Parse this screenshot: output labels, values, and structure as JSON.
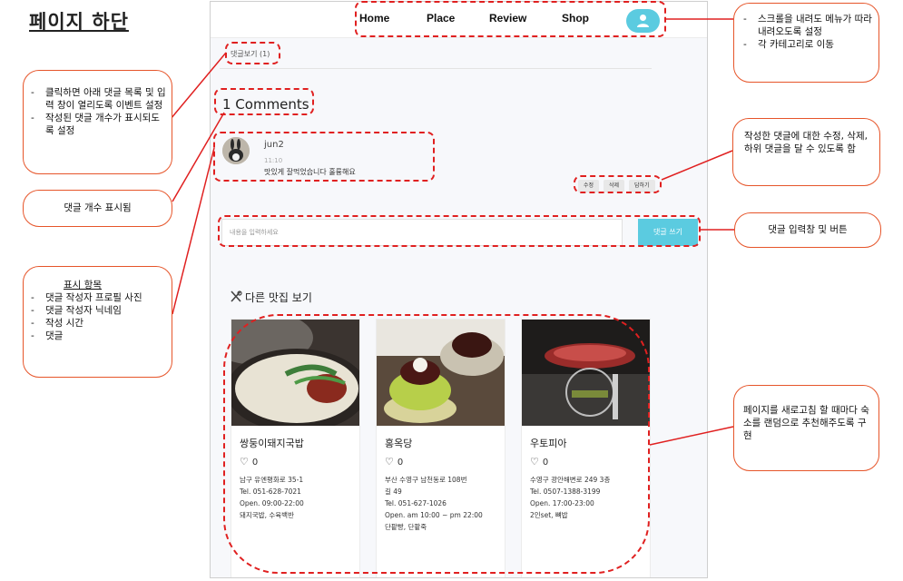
{
  "heading": "페이지 하단",
  "nav": {
    "items": [
      "Home",
      "Place",
      "Review",
      "Shop"
    ]
  },
  "comments_toggle": "댓글보기 (1)",
  "comments_title": "1 Comments",
  "comment": {
    "author": "jun2",
    "time": "11:10",
    "text": "맛있게 잘먹었습니다 훌륭해요"
  },
  "comment_actions": [
    "수정",
    "삭제",
    "답하기"
  ],
  "comment_input": {
    "placeholder": "내용을 입력하세요",
    "submit": "댓글 쓰기"
  },
  "more_title": "다른 맛집 보기",
  "restaurants": [
    {
      "name": "쌍둥이돼지국밥",
      "likes": "0",
      "info": [
        "남구 유엔평화로 35-1",
        "Tel. 051-628-7021",
        "Open. 09:00-22:00",
        "돼지국밥, 수육백반"
      ]
    },
    {
      "name": "홍옥당",
      "likes": "0",
      "info": [
        "부산 수영구 남천동로 108번",
        "길 49",
        "Tel. 051-627-1026",
        "Open. am 10:00 ~ pm 22:00",
        "단팥빵, 단팥죽"
      ]
    },
    {
      "name": "우토피아",
      "likes": "0",
      "info": [
        "수영구 광안해변로 249 3층",
        "Tel. 0507-1388-3199",
        "Open. 17:00-23:00",
        "2인set, 뼈밥"
      ]
    }
  ],
  "annotations": {
    "menu": [
      "스크롤을 내려도 메뉴가 따라 내려오도록 설정",
      "각 카테고리로 이동"
    ],
    "toggle": [
      "클릭하면 아래 댓글 목록 및 입력 창이 열리도록 이벤트 설정",
      "작성된 댓글 개수가 표시되도록 설정"
    ],
    "count": "댓글 개수 표시됨",
    "display_title": "표시 항목",
    "display_items": [
      "댓글 작성자 프로필 사진",
      "댓글 작성자 닉네임",
      "작성 시간",
      "댓글"
    ],
    "edit": "작성한 댓글에 대한 수정, 삭제, 하위 댓글을 달 수 있도록 함",
    "input": "댓글 입력창 및 버튼",
    "random": "페이지를 새로고침 할 때마다 숙소를 랜덤으로 추천해주도록 구현"
  },
  "colors": {
    "accent": "#5bcbe0",
    "annotation_red": "#e02020",
    "annotation_border": "#e6552a"
  }
}
